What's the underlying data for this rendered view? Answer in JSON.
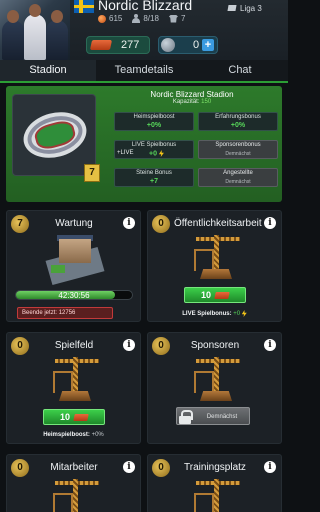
{
  "header": {
    "team_name": "Nordic Blizzard",
    "league": "Liga 3",
    "stats": [
      "615",
      "8/18",
      "7"
    ],
    "cash": "277",
    "coins": "0",
    "plus": "+"
  },
  "tabs": [
    {
      "label": "Stadion",
      "active": true
    },
    {
      "label": "Teamdetails",
      "active": false
    },
    {
      "label": "Chat",
      "active": false
    }
  ],
  "stadium": {
    "name": "Nordic Blizzard Stadion",
    "capacity_label": "Kapazität:",
    "capacity_value": "150",
    "level": "7",
    "bonuses": [
      {
        "title": "Heimspielboost",
        "value": "+0%"
      },
      {
        "title": "Erfahrungsbonus",
        "value": "+0%"
      },
      {
        "title": "LIVE Spielbonus",
        "prefix": "+LIVE",
        "value": "+0"
      },
      {
        "title": "Sponsorenbonus",
        "value": "Demnächst"
      },
      {
        "title": "Steine Bonus",
        "value": "+7"
      },
      {
        "title": "Angestellte",
        "value": "Demnächst"
      }
    ]
  },
  "buildings": [
    {
      "title": "Wartung",
      "level": "7",
      "timer": "42:30:56",
      "finish_label": "Beende jetzt: 12756"
    },
    {
      "title": "Öffentlichkeitsarbeit",
      "level": "0",
      "cost": "10",
      "bonus_label": "LIVE Spielbonus:",
      "bonus_value": "+0"
    },
    {
      "title": "Spielfeld",
      "level": "0",
      "cost": "10",
      "bonus_label": "Heimspielboost:",
      "bonus_value": "+0%"
    },
    {
      "title": "Sponsoren",
      "level": "0",
      "locked_label": "Demnächst"
    },
    {
      "title": "Mitarbeiter",
      "level": "0"
    },
    {
      "title": "Trainingsplatz",
      "level": "0"
    }
  ],
  "info_glyph": "i",
  "progress": 0.85,
  "colors": {
    "accent": "#2c9e35",
    "panel": "#2d7a2b",
    "cash": "#e86a3b",
    "card": "#1c2126"
  }
}
